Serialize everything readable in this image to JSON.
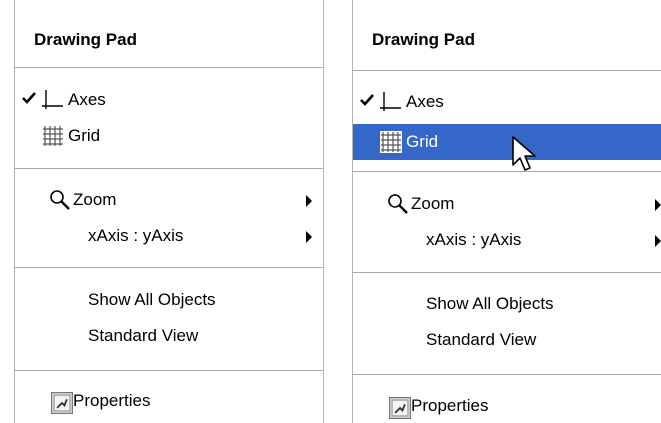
{
  "menus": [
    {
      "title": "Drawing Pad",
      "items": {
        "axes": {
          "label": "Axes",
          "checked": true,
          "icon": "axes-icon"
        },
        "grid": {
          "label": "Grid",
          "icon": "grid-icon"
        },
        "zoom": {
          "label": "Zoom",
          "icon": "magnifier-icon",
          "has_submenu": true
        },
        "axis_ratio": {
          "label": "xAxis : yAxis",
          "has_submenu": true
        },
        "show_all": {
          "label": "Show All Objects"
        },
        "standard_view": {
          "label": "Standard View"
        },
        "properties": {
          "label": "Properties",
          "icon": "properties-icon"
        }
      }
    },
    {
      "title": "Drawing Pad",
      "highlighted_item": "Grid",
      "items": {
        "axes": {
          "label": "Axes",
          "checked": true,
          "icon": "axes-icon"
        },
        "grid": {
          "label": "Grid",
          "icon": "grid-icon"
        },
        "zoom": {
          "label": "Zoom",
          "icon": "magnifier-icon",
          "has_submenu": true
        },
        "axis_ratio": {
          "label": "xAxis : yAxis",
          "has_submenu": true
        },
        "show_all": {
          "label": "Show All Objects"
        },
        "standard_view": {
          "label": "Standard View"
        },
        "properties": {
          "label": "Properties",
          "icon": "properties-icon"
        }
      }
    }
  ],
  "colors": {
    "highlight": "#3467c8",
    "separator": "#a9a9a9"
  }
}
